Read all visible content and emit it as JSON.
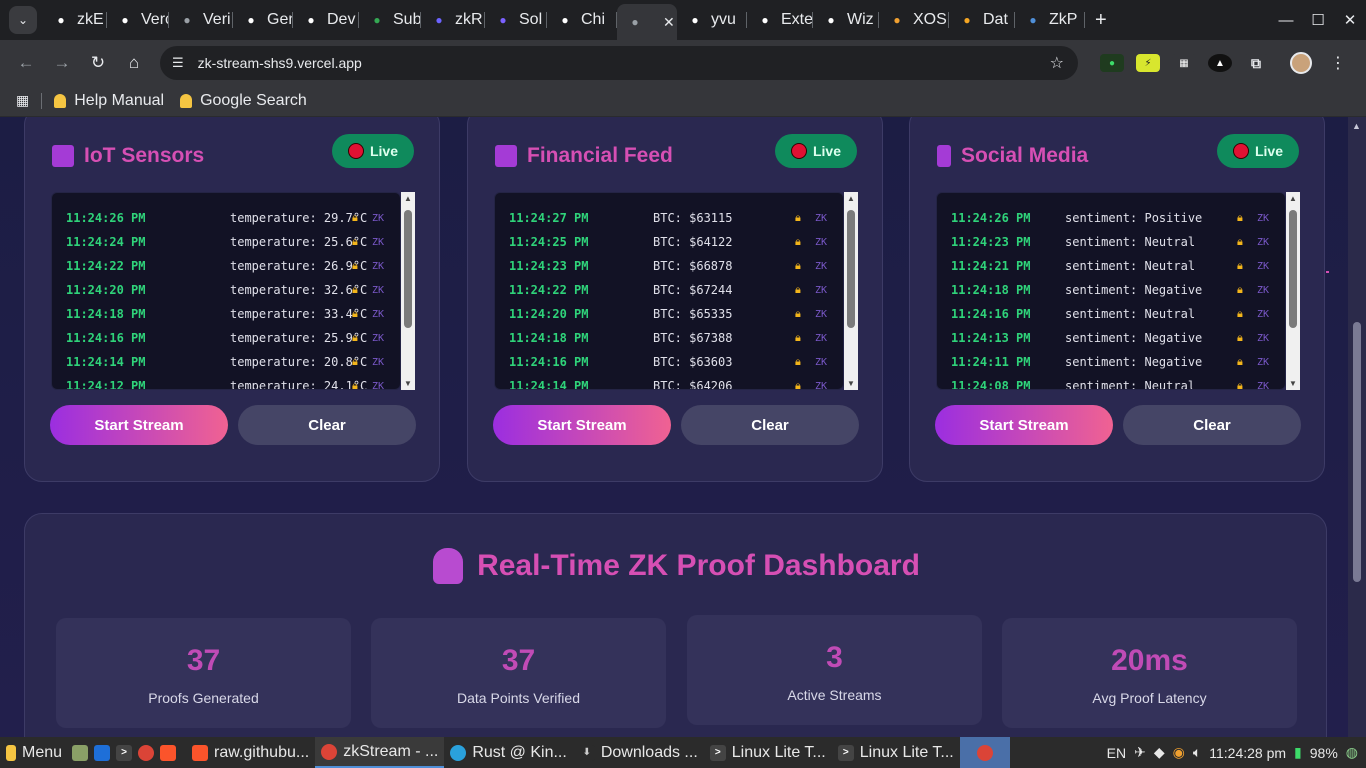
{
  "browser": {
    "tabs": [
      {
        "label": "zkE",
        "icon": "gear-icon",
        "color": "#ffffff"
      },
      {
        "label": "Verc",
        "icon": "openai-icon",
        "color": "#ffffff"
      },
      {
        "label": "Veri",
        "icon": "globe-icon",
        "color": "#9aa0a6"
      },
      {
        "label": "Gen",
        "icon": "gen-icon",
        "color": "#ffffff"
      },
      {
        "label": "Dev",
        "icon": "dev-icon",
        "color": "#ffffff"
      },
      {
        "label": "Sub",
        "icon": "sheet-icon",
        "color": "#34a853"
      },
      {
        "label": "zkR",
        "icon": "zk-icon",
        "color": "#6c63ff"
      },
      {
        "label": "Sol",
        "icon": "cube-icon",
        "color": "#7b61ff"
      },
      {
        "label": "Chi",
        "icon": "github-icon",
        "color": "#ffffff"
      },
      {
        "label": "",
        "icon": "globe-icon",
        "color": "#9aa0a6",
        "active": true
      },
      {
        "label": "yvu",
        "icon": "x-icon",
        "color": "#ffffff"
      },
      {
        "label": "Exte",
        "icon": "puzzle-icon",
        "color": "#ffffff"
      },
      {
        "label": "Wiz",
        "icon": "wiz-icon",
        "color": "#ffffff"
      },
      {
        "label": "XOS",
        "icon": "xos-icon",
        "color": "#f0a030"
      },
      {
        "label": "Dat",
        "icon": "dat-icon",
        "color": "#f5a623"
      },
      {
        "label": "ZkP",
        "icon": "doc-icon",
        "color": "#4f8fd8"
      }
    ],
    "url": "zk-stream-shs9.vercel.app",
    "bookmarks": [
      {
        "label": "Help Manual"
      },
      {
        "label": "Google Search"
      }
    ]
  },
  "streams": [
    {
      "title": "IoT Sensors",
      "live_label": "Live",
      "rows": [
        {
          "ts": "11:24:26 PM",
          "val": "temperature: 29.7°C"
        },
        {
          "ts": "11:24:24 PM",
          "val": "temperature: 25.6°C"
        },
        {
          "ts": "11:24:22 PM",
          "val": "temperature: 26.9°C"
        },
        {
          "ts": "11:24:20 PM",
          "val": "temperature: 32.6°C"
        },
        {
          "ts": "11:24:18 PM",
          "val": "temperature: 33.4°C"
        },
        {
          "ts": "11:24:16 PM",
          "val": "temperature: 25.9°C"
        },
        {
          "ts": "11:24:14 PM",
          "val": "temperature: 20.8°C"
        },
        {
          "ts": "11:24:12 PM",
          "val": "temperature: 24.1°C"
        }
      ],
      "start_label": "Start Stream",
      "clear_label": "Clear"
    },
    {
      "title": "Financial Feed",
      "live_label": "Live",
      "rows": [
        {
          "ts": "11:24:27 PM",
          "val": "BTC: $63115"
        },
        {
          "ts": "11:24:25 PM",
          "val": "BTC: $64122"
        },
        {
          "ts": "11:24:23 PM",
          "val": "BTC: $66878"
        },
        {
          "ts": "11:24:22 PM",
          "val": "BTC: $67244"
        },
        {
          "ts": "11:24:20 PM",
          "val": "BTC: $65335"
        },
        {
          "ts": "11:24:18 PM",
          "val": "BTC: $67388"
        },
        {
          "ts": "11:24:16 PM",
          "val": "BTC: $63603"
        },
        {
          "ts": "11:24:14 PM",
          "val": "BTC: $64206"
        }
      ],
      "start_label": "Start Stream",
      "clear_label": "Clear"
    },
    {
      "title": "Social Media",
      "live_label": "Live",
      "rows": [
        {
          "ts": "11:24:26 PM",
          "val": "sentiment: Positive"
        },
        {
          "ts": "11:24:23 PM",
          "val": "sentiment: Neutral"
        },
        {
          "ts": "11:24:21 PM",
          "val": "sentiment: Neutral"
        },
        {
          "ts": "11:24:18 PM",
          "val": "sentiment: Negative"
        },
        {
          "ts": "11:24:16 PM",
          "val": "sentiment: Neutral"
        },
        {
          "ts": "11:24:13 PM",
          "val": "sentiment: Negative"
        },
        {
          "ts": "11:24:11 PM",
          "val": "sentiment: Negative"
        },
        {
          "ts": "11:24:08 PM",
          "val": "sentiment: Neutral"
        }
      ],
      "start_label": "Start Stream",
      "clear_label": "Clear"
    }
  ],
  "row_tag": "ZK",
  "dashboard": {
    "title": "Real-Time ZK Proof Dashboard",
    "stats": [
      {
        "value": "37",
        "label": "Proofs Generated"
      },
      {
        "value": "37",
        "label": "Data Points Verified"
      },
      {
        "value": "3",
        "label": "Active Streams"
      },
      {
        "value": "20ms",
        "label": "Avg Proof Latency"
      }
    ]
  },
  "taskbar": {
    "menu_label": "Menu",
    "items": [
      {
        "label": "raw.githubu..."
      },
      {
        "label": "zkStream - ..."
      },
      {
        "label": "Rust @ Kin..."
      },
      {
        "label": "Downloads ..."
      },
      {
        "label": "Linux Lite T..."
      },
      {
        "label": "Linux Lite T..."
      }
    ],
    "lang": "EN",
    "clock": "11:24:28 pm",
    "battery": "98%"
  },
  "colors": {
    "accent": "#d64fb4",
    "live_green": "#0f8a5c",
    "timestamp_green": "#2fd37a",
    "lock_amber": "#f3b51b"
  }
}
